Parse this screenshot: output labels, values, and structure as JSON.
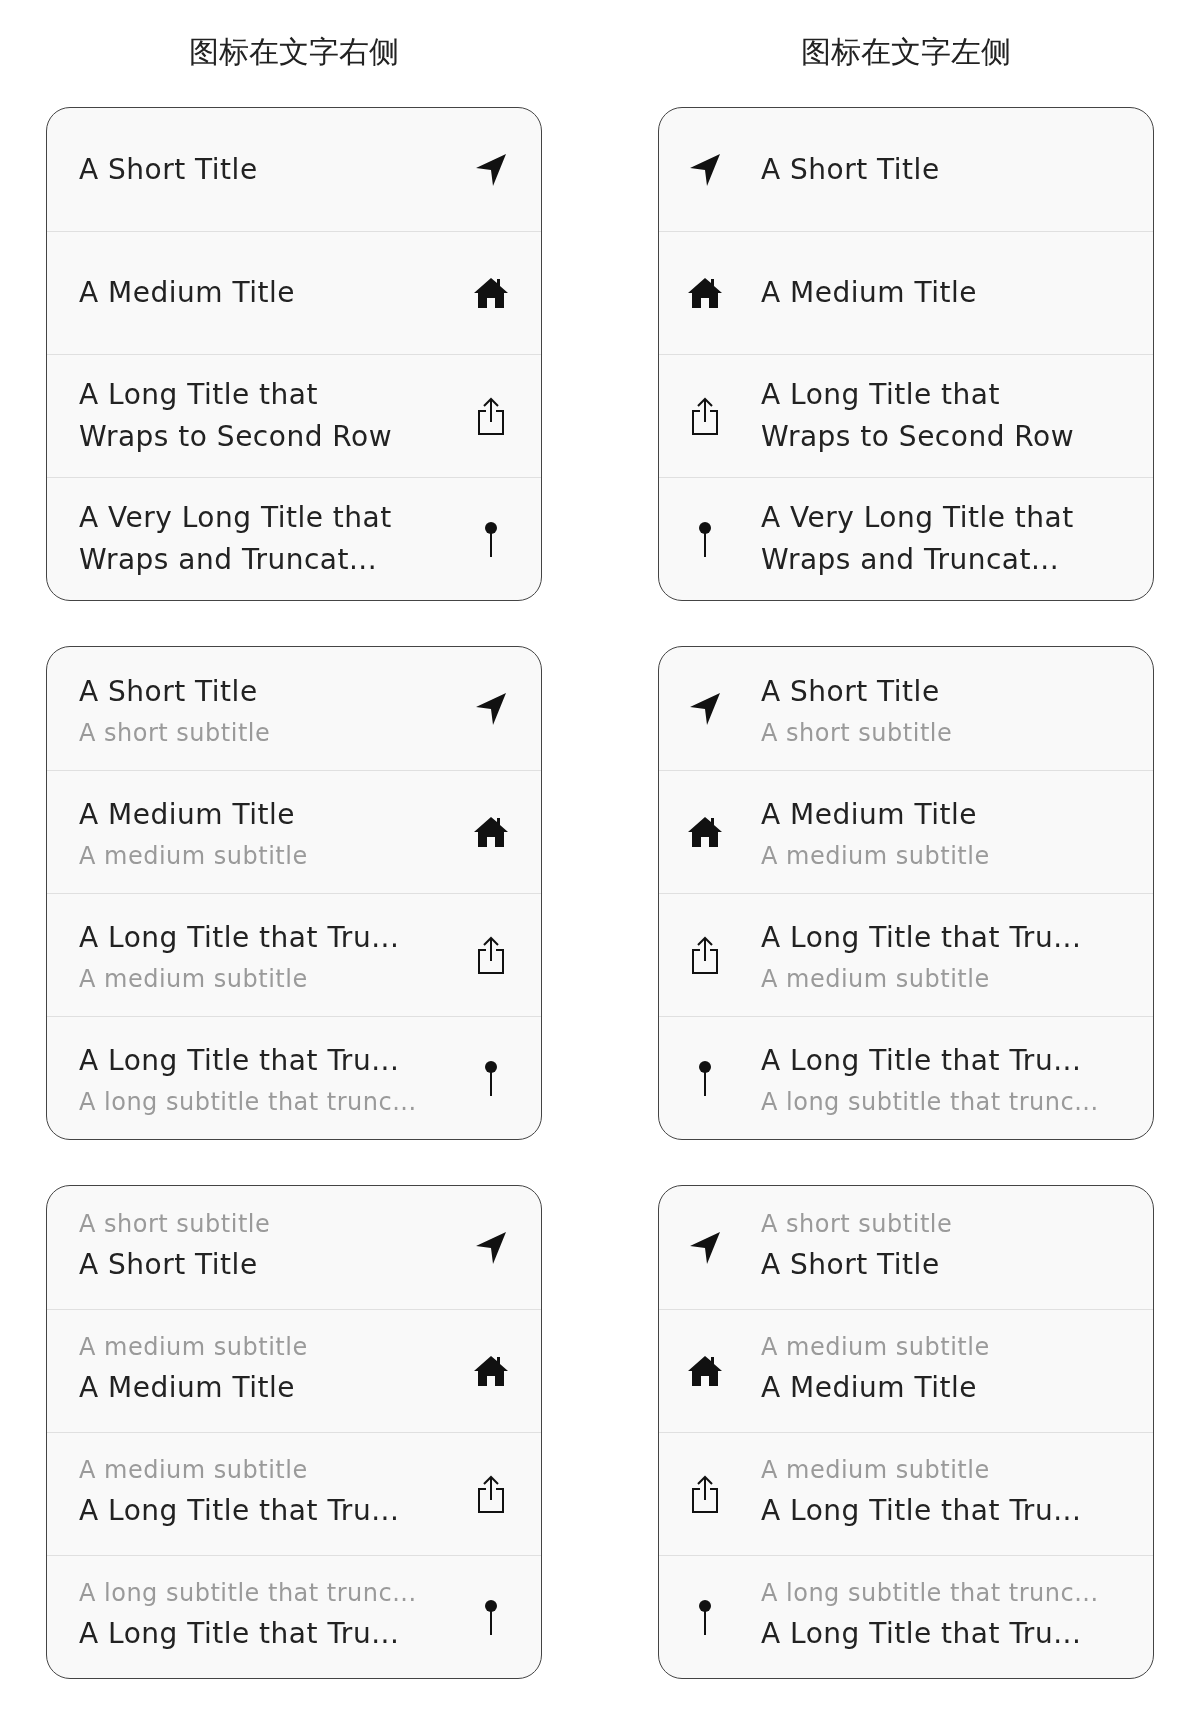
{
  "columns": [
    {
      "heading": "图标在文字右侧",
      "kind": "trailing",
      "groups": [
        {
          "kind": "plain",
          "rows": [
            {
              "title": "A Short Title"
            },
            {
              "title": "A Medium Title"
            },
            {
              "title": "A Long Title that Wraps to Second Row"
            },
            {
              "title": "A Very Long Title that Wraps and Truncat..."
            }
          ]
        },
        {
          "kind": "subtitled",
          "rows": [
            {
              "title": "A Short Title",
              "subtitle": "A short subtitle"
            },
            {
              "title": "A Medium Title",
              "subtitle": "A medium subtitle"
            },
            {
              "title": "A Long Title that Tru...",
              "subtitle": "A medium subtitle"
            },
            {
              "title": "A Long Title that Tru...",
              "subtitle": "A long subtitle that trunc..."
            }
          ]
        },
        {
          "kind": "overtitled",
          "rows": [
            {
              "title": "A Short Title",
              "subtitle": "A short subtitle"
            },
            {
              "title": "A Medium Title",
              "subtitle": "A medium subtitle"
            },
            {
              "title": "A Long Title that Tru...",
              "subtitle": "A medium subtitle"
            },
            {
              "title": "A Long Title that Tru...",
              "subtitle": "A long subtitle that trunc..."
            }
          ]
        }
      ]
    },
    {
      "heading": "图标在文字左侧",
      "kind": "leading",
      "groups": [
        {
          "kind": "plain",
          "rows": [
            {
              "title": "A Short Title"
            },
            {
              "title": "A Medium Title"
            },
            {
              "title": "A Long Title that Wraps to Second Row"
            },
            {
              "title": "A Very Long Title that Wraps and Truncat..."
            }
          ]
        },
        {
          "kind": "subtitled",
          "rows": [
            {
              "title": "A Short Title",
              "subtitle": "A short subtitle"
            },
            {
              "title": "A Medium Title",
              "subtitle": "A medium subtitle"
            },
            {
              "title": "A Long Title that Tru...",
              "subtitle": "A medium subtitle"
            },
            {
              "title": "A Long Title that Tru...",
              "subtitle": "A long subtitle that trunc..."
            }
          ]
        },
        {
          "kind": "overtitled",
          "rows": [
            {
              "title": "A Short Title",
              "subtitle": "A short subtitle"
            },
            {
              "title": "A Medium Title",
              "subtitle": "A medium subtitle"
            },
            {
              "title": "A Long Title that Tru...",
              "subtitle": "A medium subtitle"
            },
            {
              "title": "A Long Title that Tru...",
              "subtitle": "A long subtitle that trunc..."
            }
          ]
        }
      ]
    }
  ]
}
